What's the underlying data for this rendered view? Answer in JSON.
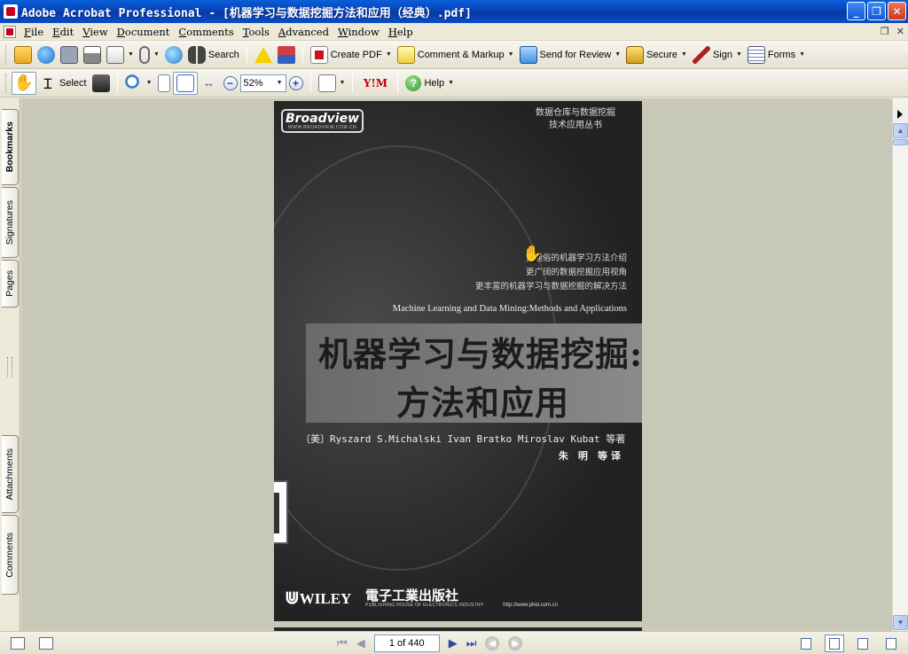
{
  "window": {
    "title": "Adobe Acrobat Professional - [机器学习与数据挖掘方法和应用（经典）.pdf]",
    "minimize": "_",
    "restore": "❐",
    "close": "✕"
  },
  "menu": {
    "items": [
      "File",
      "Edit",
      "View",
      "Document",
      "Comments",
      "Tools",
      "Advanced",
      "Window",
      "Help"
    ],
    "mdi_restore": "❐",
    "mdi_close": "✕"
  },
  "toolbar1": {
    "search_label": "Search",
    "create_pdf_label": "Create PDF",
    "comment_markup_label": "Comment & Markup",
    "send_review_label": "Send for Review",
    "secure_label": "Secure",
    "sign_label": "Sign",
    "forms_label": "Forms"
  },
  "toolbar2": {
    "select_label": "Select",
    "zoom_value": "52%",
    "help_label": "Help",
    "yahoo_label": "Y!M"
  },
  "nav_tabs": [
    "Bookmarks",
    "Signatures",
    "Pages",
    "Attachments",
    "Comments"
  ],
  "page": {
    "brand": "Broadview",
    "brand_url": "WWW.BROADVIEW.COM.CN",
    "series_line1": "数据仓库与数据挖掘",
    "series_line2": "技术应用丛书",
    "tagline1": "更通俗的机器学习方法介绍",
    "tagline2": "更广阔的数据挖掘应用视角",
    "tagline3": "更丰富的机器学习与数据挖掘的解决方法",
    "english_title": "Machine Learning and Data Mining:Methods and Applications",
    "title_line1": "机器学习与数据挖掘:",
    "title_line2": "方法和应用",
    "authors": "〔美〕Ryszard S.Michalski  Ivan Bratko  Miroslav Kubat 等著",
    "translator": "朱 明 等译",
    "publisher1": "WILEY",
    "publisher2": "電子工業出版社",
    "publisher2_en": "PUBLISHING HOUSE OF ELECTRONICS INDUSTRY",
    "publisher_url": "http://www.phei.com.cn"
  },
  "status": {
    "page_indicator": "1 of 440"
  }
}
